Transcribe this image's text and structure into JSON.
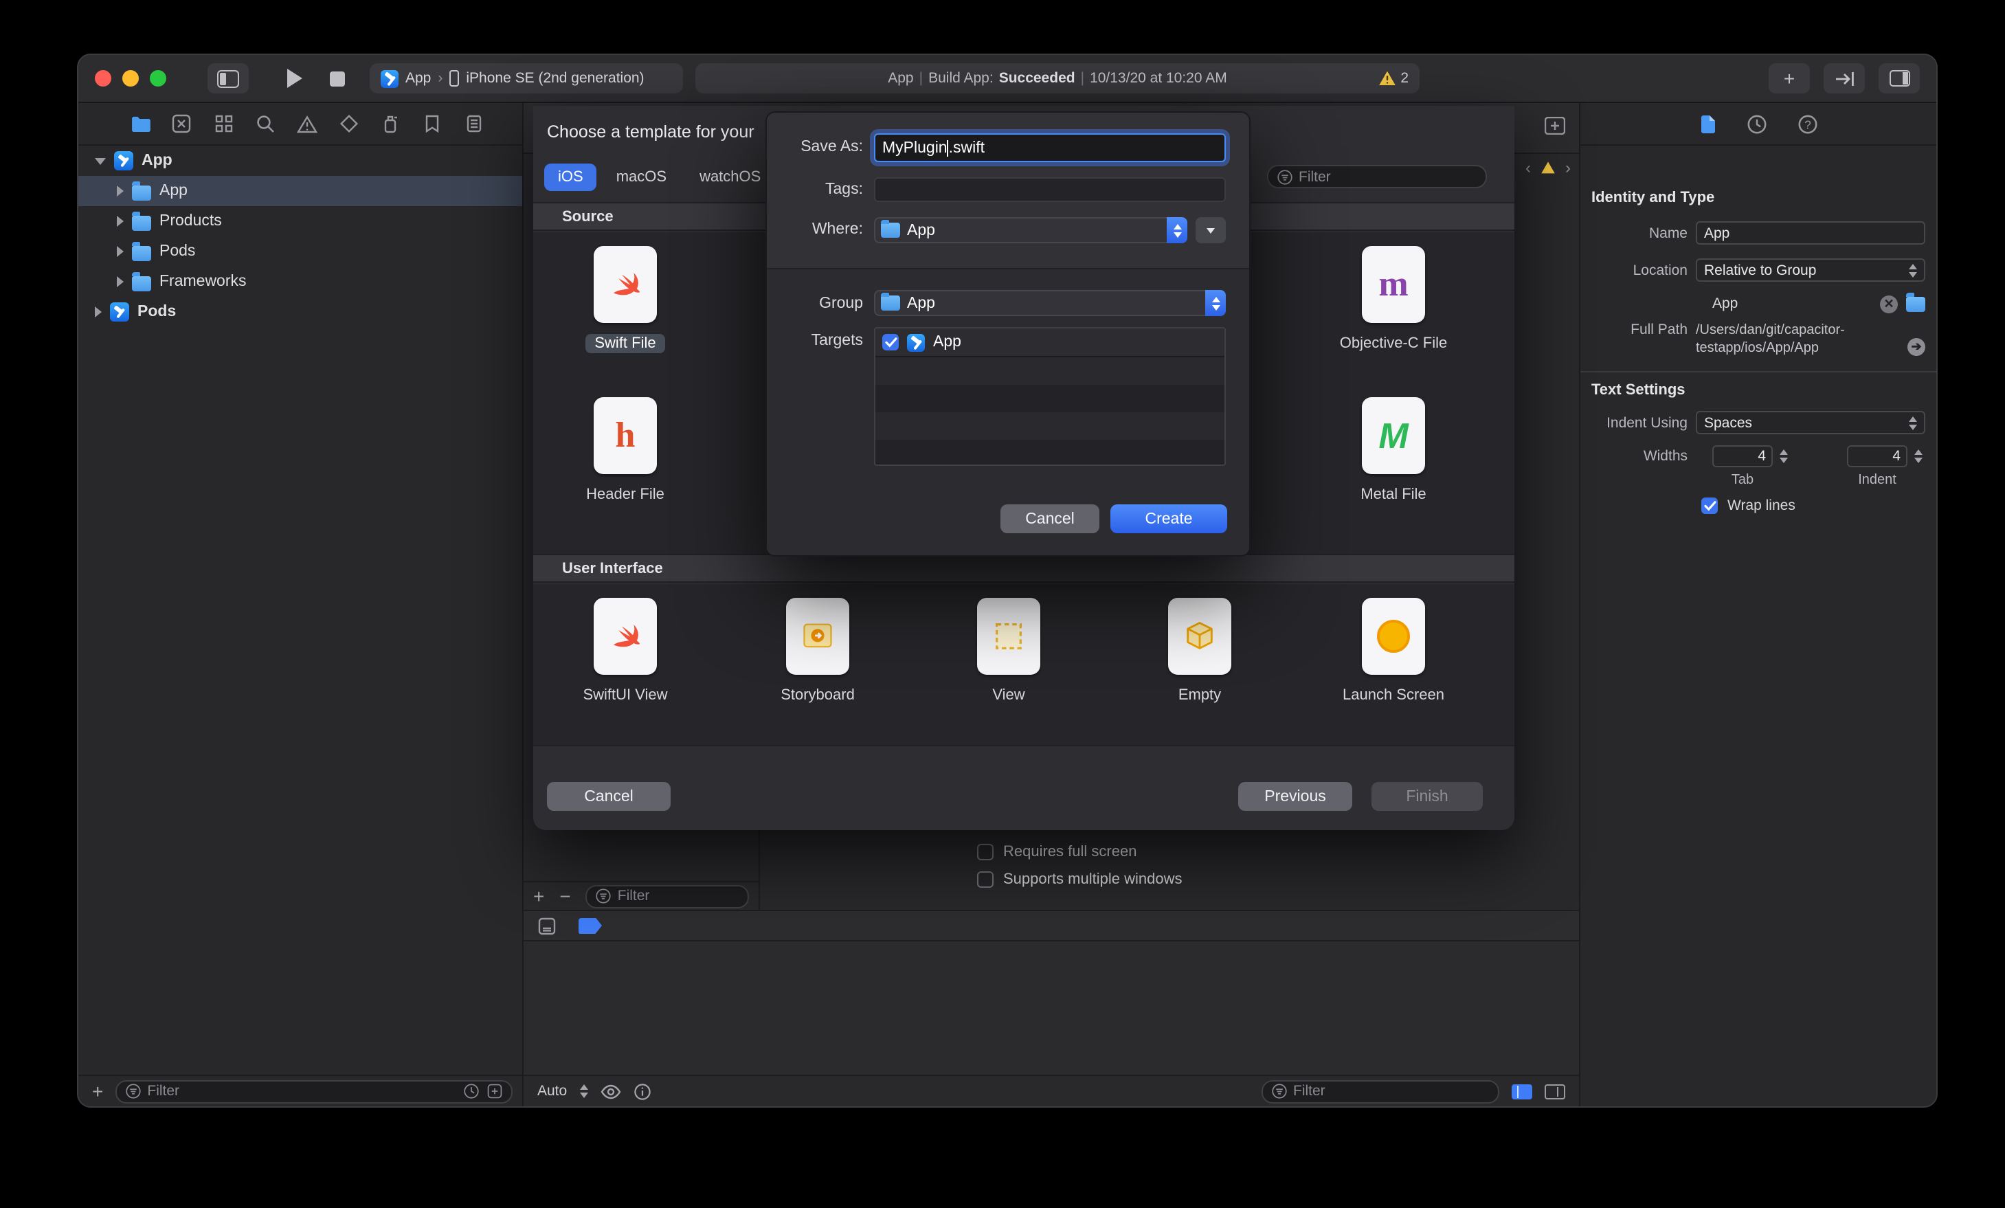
{
  "toolbar": {
    "scheme_app": "App",
    "scheme_sep": "›",
    "scheme_device": "iPhone SE (2nd generation)",
    "status_app": "App",
    "status_sep": "|",
    "status_build_label": "Build App:",
    "status_build_result": "Succeeded",
    "status_time": "10/13/20 at 10:20 AM",
    "warning_count": "2"
  },
  "navigator": {
    "items": [
      {
        "label": "App"
      },
      {
        "label": "App"
      },
      {
        "label": "Products"
      },
      {
        "label": "Pods"
      },
      {
        "label": "Frameworks"
      },
      {
        "label": "Pods"
      }
    ],
    "filter_placeholder": "Filter"
  },
  "sheet": {
    "title": "Choose a template for your",
    "tabs": [
      "iOS",
      "macOS",
      "watchOS"
    ],
    "filter_placeholder": "Filter",
    "source_title": "Source",
    "ui_title": "User Interface",
    "source_items": [
      "Swift File",
      "Objective-C File",
      "Header File",
      "Metal File"
    ],
    "ui_items": [
      "SwiftUI View",
      "Storyboard",
      "View",
      "Empty",
      "Launch Screen"
    ],
    "cancel": "Cancel",
    "previous": "Previous",
    "finish": "Finish"
  },
  "dialog": {
    "save_as_label": "Save As:",
    "filename_pre": "MyPlugin",
    "filename_post": ".swift",
    "tags_label": "Tags:",
    "where_label": "Where:",
    "where_value": "App",
    "group_label": "Group",
    "group_value": "App",
    "targets_label": "Targets",
    "target_name": "App",
    "cancel": "Cancel",
    "create": "Create"
  },
  "editor": {
    "checkbox_fullscreen": "Requires full screen",
    "checkbox_multiwindow": "Supports multiple windows",
    "sidebar_filter_placeholder": "Filter",
    "auto": "Auto",
    "bottom_filter_placeholder": "Filter"
  },
  "inspector": {
    "identity_title": "Identity and Type",
    "name_label": "Name",
    "name_value": "App",
    "location_label": "Location",
    "location_value": "Relative to Group",
    "file_name": "App",
    "fullpath_label": "Full Path",
    "fullpath_lines": [
      "/Users/dan/git/capacitor-",
      "testapp/ios/App/App"
    ],
    "text_title": "Text Settings",
    "indent_label": "Indent Using",
    "indent_value": "Spaces",
    "widths_label": "Widths",
    "tab_value": "4",
    "tab_label": "Tab",
    "indent_width_value": "4",
    "indent_width_label": "Indent",
    "wrap_label": "Wrap lines"
  }
}
